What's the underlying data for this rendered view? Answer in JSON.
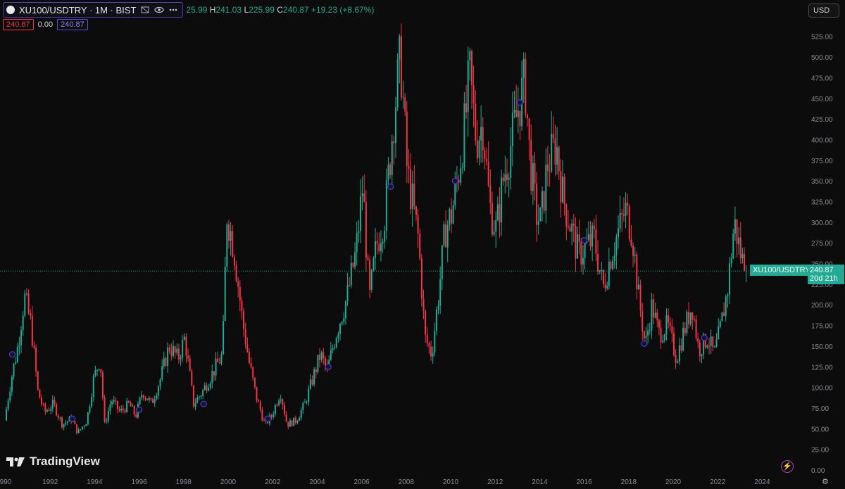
{
  "legend": {
    "symbol": "XU100/USDTRY · 1M · BIST",
    "open_label": "",
    "open_value": "25.99",
    "high_label": "H",
    "high_value": "241.03",
    "low_label": "L",
    "low_value": "225.99",
    "close_label": "C",
    "close_value": "240.87",
    "change": "+19.23 (+8.67%)",
    "box_red": "240.87",
    "mid_value": "0.00",
    "box_blue": "240.87"
  },
  "currency_button": "USD",
  "price_tag": {
    "name": "XU100/USDTRY",
    "price": "240.87",
    "countdown": "20d 21h"
  },
  "brand": "TradingView",
  "icons": {
    "eye": "eye-icon",
    "flag": "flag-icon",
    "settings": "settings-icon",
    "bolt": "lightning-icon",
    "gear": "gear-icon"
  },
  "colors": {
    "up": "#22ab94",
    "down": "#f23645",
    "background": "#0c0c0c",
    "accent": "#5b4ddb"
  },
  "chart_data": {
    "type": "candlestick",
    "y_ticks": [
      "0.00",
      "25.00",
      "50.00",
      "75.00",
      "100.00",
      "125.00",
      "150.00",
      "175.00",
      "200.00",
      "225.00",
      "250.00",
      "275.00",
      "300.00",
      "325.00",
      "350.00",
      "375.00",
      "400.00",
      "425.00",
      "450.00",
      "475.00",
      "500.00",
      "525.00"
    ],
    "x_ticks": [
      "990",
      "1992",
      "1994",
      "1996",
      "1998",
      "2000",
      "2002",
      "2004",
      "2006",
      "2008",
      "2010",
      "2012",
      "2014",
      "2016",
      "2018",
      "2020",
      "2022",
      "2024"
    ],
    "ylim": [
      0,
      535
    ],
    "x_range": [
      1990,
      2024
    ],
    "last_price": 240.87,
    "grid": false,
    "anchors": [
      [
        1990.0,
        60
      ],
      [
        1990.3,
        110
      ],
      [
        1990.6,
        150
      ],
      [
        1990.9,
        210
      ],
      [
        1991.2,
        175
      ],
      [
        1991.5,
        95
      ],
      [
        1991.8,
        70
      ],
      [
        1992.2,
        80
      ],
      [
        1992.6,
        55
      ],
      [
        1993.0,
        62
      ],
      [
        1993.3,
        45
      ],
      [
        1993.7,
        60
      ],
      [
        1994.0,
        110
      ],
      [
        1994.3,
        135
      ],
      [
        1994.5,
        55
      ],
      [
        1994.8,
        85
      ],
      [
        1995.2,
        70
      ],
      [
        1995.6,
        80
      ],
      [
        1995.9,
        65
      ],
      [
        1996.2,
        95
      ],
      [
        1996.6,
        80
      ],
      [
        1997.0,
        110
      ],
      [
        1997.4,
        150
      ],
      [
        1997.8,
        135
      ],
      [
        1998.1,
        160
      ],
      [
        1998.5,
        80
      ],
      [
        1998.9,
        95
      ],
      [
        1999.3,
        115
      ],
      [
        1999.8,
        140
      ],
      [
        2000.0,
        310
      ],
      [
        2000.3,
        270
      ],
      [
        2000.7,
        180
      ],
      [
        2001.0,
        130
      ],
      [
        2001.3,
        90
      ],
      [
        2001.7,
        55
      ],
      [
        2002.0,
        65
      ],
      [
        2002.4,
        95
      ],
      [
        2002.7,
        55
      ],
      [
        2003.1,
        60
      ],
      [
        2003.5,
        80
      ],
      [
        2003.9,
        115
      ],
      [
        2004.2,
        140
      ],
      [
        2004.5,
        120
      ],
      [
        2004.9,
        165
      ],
      [
        2005.4,
        210
      ],
      [
        2005.8,
        265
      ],
      [
        2006.1,
        345
      ],
      [
        2006.4,
        205
      ],
      [
        2006.7,
        270
      ],
      [
        2007.1,
        310
      ],
      [
        2007.5,
        430
      ],
      [
        2007.8,
        500
      ],
      [
        2008.1,
        360
      ],
      [
        2008.3,
        330
      ],
      [
        2008.6,
        280
      ],
      [
        2008.9,
        160
      ],
      [
        2009.2,
        140
      ],
      [
        2009.5,
        210
      ],
      [
        2009.8,
        290
      ],
      [
        2010.1,
        310
      ],
      [
        2010.4,
        360
      ],
      [
        2010.7,
        420
      ],
      [
        2010.9,
        480
      ],
      [
        2011.2,
        400
      ],
      [
        2011.5,
        420
      ],
      [
        2011.8,
        320
      ],
      [
        2012.1,
        290
      ],
      [
        2012.4,
        350
      ],
      [
        2012.8,
        400
      ],
      [
        2013.1,
        440
      ],
      [
        2013.4,
        470
      ],
      [
        2013.6,
        380
      ],
      [
        2013.9,
        310
      ],
      [
        2014.1,
        300
      ],
      [
        2014.4,
        370
      ],
      [
        2014.8,
        395
      ],
      [
        2015.1,
        330
      ],
      [
        2015.4,
        300
      ],
      [
        2015.8,
        260
      ],
      [
        2016.1,
        270
      ],
      [
        2016.5,
        280
      ],
      [
        2016.9,
        220
      ],
      [
        2017.2,
        255
      ],
      [
        2017.6,
        290
      ],
      [
        2017.9,
        315
      ],
      [
        2018.2,
        290
      ],
      [
        2018.5,
        210
      ],
      [
        2018.8,
        150
      ],
      [
        2019.1,
        200
      ],
      [
        2019.4,
        165
      ],
      [
        2019.8,
        175
      ],
      [
        2020.2,
        135
      ],
      [
        2020.5,
        165
      ],
      [
        2020.9,
        200
      ],
      [
        2021.2,
        145
      ],
      [
        2021.6,
        160
      ],
      [
        2021.9,
        140
      ],
      [
        2022.2,
        175
      ],
      [
        2022.5,
        220
      ],
      [
        2022.8,
        300
      ],
      [
        2023.1,
        260
      ],
      [
        2023.3,
        241
      ]
    ]
  }
}
